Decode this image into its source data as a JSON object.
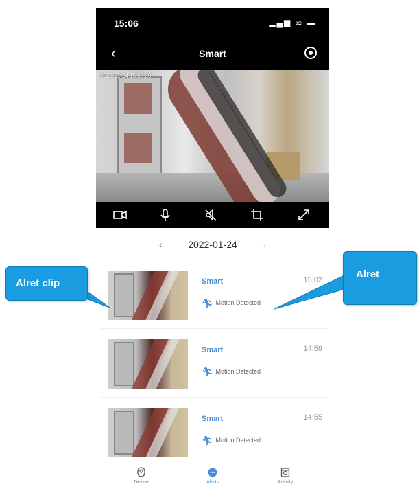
{
  "status_bar": {
    "time": "15:06",
    "signal_icons": "▂▄▆ ≋ ▬"
  },
  "nav": {
    "title": "Smart",
    "back_icon": "back-icon",
    "settings_icon": "settings-icon"
  },
  "video": {
    "timestamp": "2022-01-24 15:06:39"
  },
  "controls": [
    "record-icon",
    "microphone-icon",
    "speaker-mute-icon",
    "crop-icon",
    "fullscreen-icon"
  ],
  "date_nav": {
    "prev": "‹",
    "date": "2022-01-24",
    "next": "›"
  },
  "alerts": [
    {
      "title": "Smart",
      "time": "15:02",
      "event": "Motion Detected"
    },
    {
      "title": "Smart",
      "time": "14:59",
      "event": "Motion Detected"
    },
    {
      "title": "Smart",
      "time": "14:55",
      "event": "Motion Detected"
    }
  ],
  "tabs": [
    {
      "label": "Device",
      "icon": "device-icon"
    },
    {
      "label": "Alerts",
      "icon": "alerts-icon"
    },
    {
      "label": "Activity",
      "icon": "activity-icon"
    }
  ],
  "callouts": {
    "clip": "Alret clip",
    "alert": "Alret"
  },
  "colors": {
    "accent": "#4a8fd6",
    "callout": "#1a9ce0",
    "bar": "#000000"
  }
}
